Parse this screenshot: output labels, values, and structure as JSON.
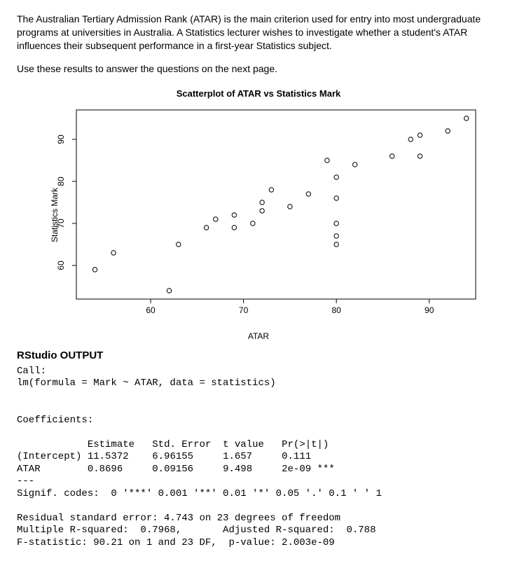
{
  "intro": {
    "p1": "The Australian Tertiary Admission Rank (ATAR) is the main criterion used for entry into most undergraduate programs at universities in Australia. A Statistics lecturer wishes to investigate whether a student's ATAR influences their subsequent performance in a first-year Statistics subject.",
    "p2": "Use these results to answer the questions on the next page."
  },
  "chart_data": {
    "type": "scatter",
    "title": "Scatterplot of ATAR vs Statistics Mark",
    "xlabel": "ATAR",
    "ylabel": "Statistics Mark",
    "xlim": [
      52,
      95
    ],
    "ylim": [
      52,
      97
    ],
    "xticks": [
      60,
      70,
      80,
      90
    ],
    "yticks": [
      60,
      70,
      80,
      90
    ],
    "points": [
      {
        "x": 54,
        "y": 59
      },
      {
        "x": 56,
        "y": 63
      },
      {
        "x": 62,
        "y": 54
      },
      {
        "x": 63,
        "y": 65
      },
      {
        "x": 66,
        "y": 69
      },
      {
        "x": 67,
        "y": 71
      },
      {
        "x": 69,
        "y": 69
      },
      {
        "x": 69,
        "y": 72
      },
      {
        "x": 71,
        "y": 70
      },
      {
        "x": 72,
        "y": 73
      },
      {
        "x": 72,
        "y": 75
      },
      {
        "x": 73,
        "y": 78
      },
      {
        "x": 75,
        "y": 74
      },
      {
        "x": 77,
        "y": 77
      },
      {
        "x": 79,
        "y": 85
      },
      {
        "x": 80,
        "y": 65
      },
      {
        "x": 80,
        "y": 67
      },
      {
        "x": 80,
        "y": 70
      },
      {
        "x": 80,
        "y": 76
      },
      {
        "x": 80,
        "y": 81
      },
      {
        "x": 82,
        "y": 84
      },
      {
        "x": 86,
        "y": 86
      },
      {
        "x": 88,
        "y": 90
      },
      {
        "x": 89,
        "y": 91
      },
      {
        "x": 89,
        "y": 86
      },
      {
        "x": 92,
        "y": 92
      },
      {
        "x": 94,
        "y": 95
      }
    ]
  },
  "rstudio": {
    "heading": "RStudio OUTPUT",
    "call_label": "Call:",
    "call_text": "lm(formula = Mark ~ ATAR, data = statistics)",
    "coef_label": "Coefficients:",
    "header_estimate": "Estimate",
    "header_se": "Std. Error",
    "header_t": "t value",
    "header_p": "Pr(>|t|)",
    "row_intercept_name": "(Intercept)",
    "row_intercept_est": "11.5372",
    "row_intercept_se": "6.96155",
    "row_intercept_t": "1.657",
    "row_intercept_p": "0.111",
    "row_atar_name": "ATAR",
    "row_atar_est": "0.8696",
    "row_atar_se": "0.09156",
    "row_atar_t": "9.498",
    "row_atar_p": "2e-09 ***",
    "sep": "---",
    "signif": "Signif. codes:  0 '***' 0.001 '**' 0.01 '*' 0.05 '.' 0.1 ' ' 1",
    "resid": "Residual standard error: 4.743 on 23 degrees of freedom",
    "r2": "Multiple R-squared:  0.7968,       Adjusted R-squared:  0.788",
    "fstat": "F-statistic: 90.21 on 1 and 23 DF,  p-value: 2.003e-09"
  }
}
